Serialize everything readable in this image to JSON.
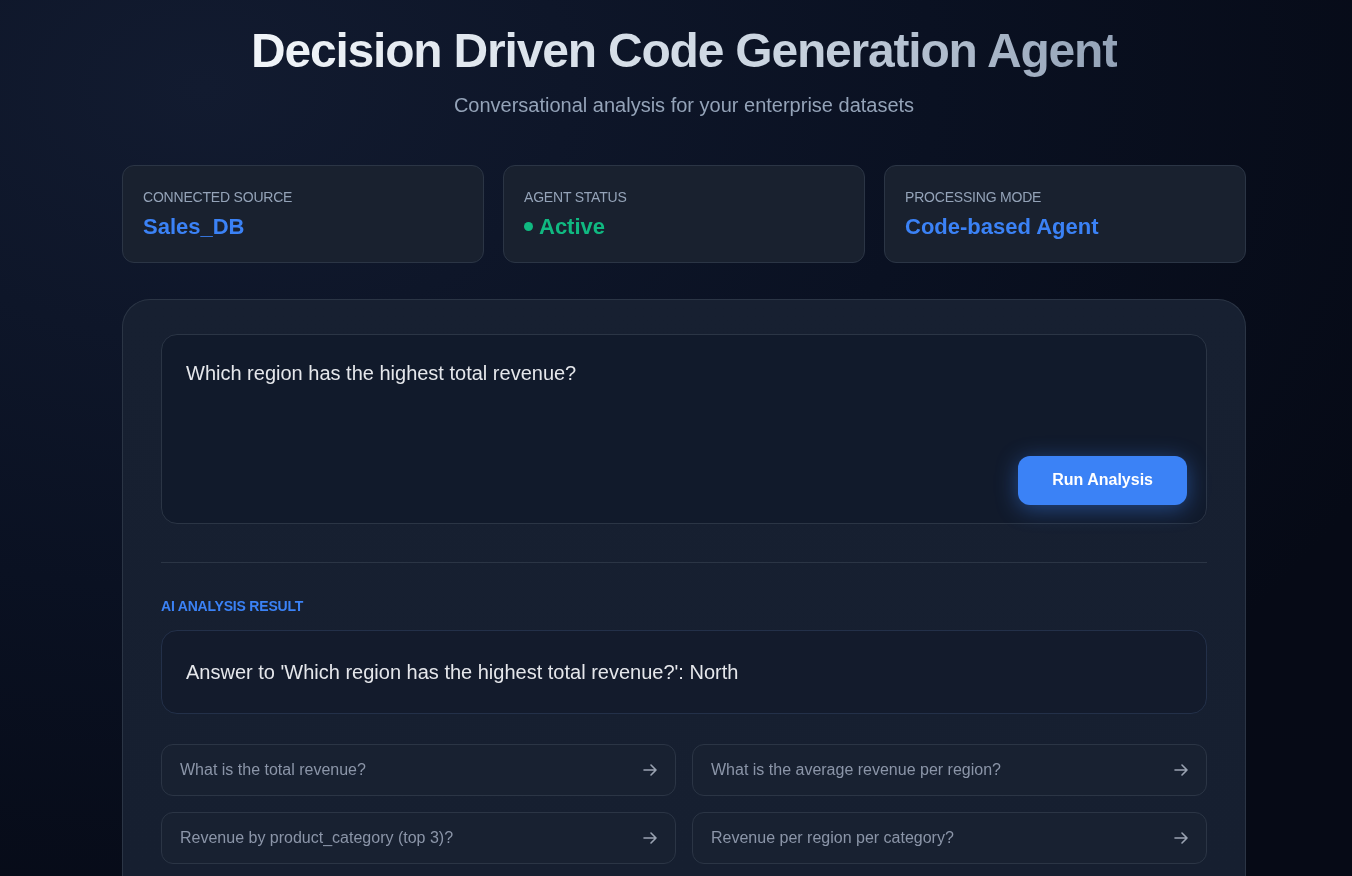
{
  "header": {
    "title": "Decision Driven Code Generation Agent",
    "subtitle": "Conversational analysis for your enterprise datasets"
  },
  "stats": [
    {
      "label": "CONNECTED SOURCE",
      "value": "Sales_DB",
      "kind": "text"
    },
    {
      "label": "AGENT STATUS",
      "value": "Active",
      "kind": "status"
    },
    {
      "label": "PROCESSING MODE",
      "value": "Code-based Agent",
      "kind": "text"
    }
  ],
  "query": {
    "value": "Which region has the highest total revenue?",
    "button": "Run Analysis"
  },
  "result": {
    "heading": "AI ANALYSIS RESULT",
    "answer": "Answer to 'Which region has the highest total revenue?': North"
  },
  "suggestions": [
    "What is the total revenue?",
    "What is the average revenue per region?",
    "Revenue by product_category (top 3)?",
    "Revenue per region per category?"
  ]
}
